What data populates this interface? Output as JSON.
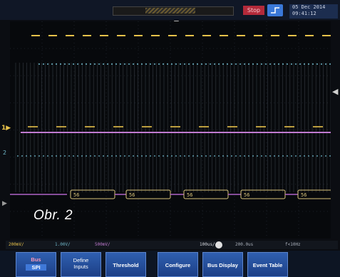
{
  "top_bar": {
    "run_state": "Stop",
    "datetime_line1": "05 Dec 2014",
    "datetime_line2": "09:41:12"
  },
  "overlay": {
    "figure_label": "Obr. 2"
  },
  "status_bar": {
    "ch1": "200mV/",
    "ch2": "1.00V/",
    "ch3": "500mV/",
    "timebase": "100us/",
    "trigger": "200.0us",
    "freq": "f<10Hz"
  },
  "softkeys": [
    {
      "label": "Bus",
      "value": "SPI"
    },
    {
      "label_line1": "Define",
      "label_line2": "Inputs"
    },
    {
      "label": "Threshold"
    },
    {
      "label": "Configure"
    },
    {
      "label": "Bus Display"
    },
    {
      "label": "Event Table"
    }
  ],
  "decode": {
    "frame_labels": [
      "56",
      "56",
      "56",
      "56",
      "56"
    ]
  },
  "channels": [
    {
      "name": "CH1",
      "color": "#e8c24a"
    },
    {
      "name": "CH2",
      "color": "#6fb6c8"
    },
    {
      "name": "CH3",
      "color": "#c07ad0"
    }
  ],
  "theme": {
    "softkey_bg": "#2f5fb0",
    "run_badge": "#b32a3a",
    "trigger_icon_bg": "#3a78d8"
  }
}
